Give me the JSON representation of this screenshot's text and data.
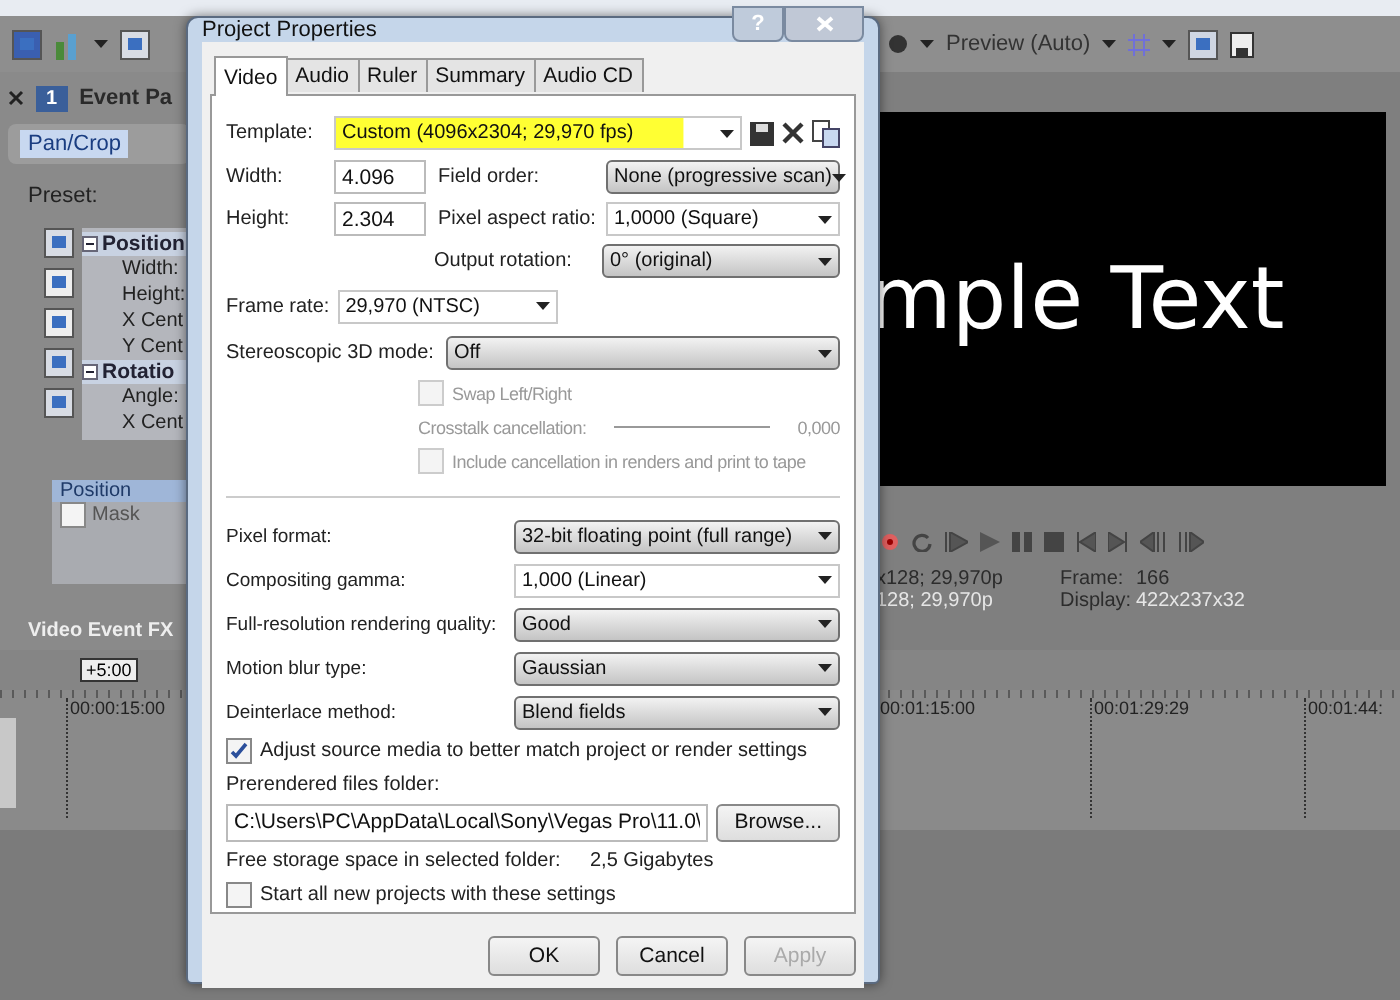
{
  "app": {
    "preview_toolbar": {
      "label": "Preview (Auto)"
    },
    "event_panel": {
      "tab_number": "1",
      "title": "Event Pa",
      "chip": "Pan/Crop",
      "preset_label": "Preset:",
      "tree": [
        {
          "label": "Position",
          "expanded": true,
          "children": [
            {
              "label": "Width:"
            },
            {
              "label": "Height:"
            },
            {
              "label": "X Cent"
            },
            {
              "label": "Y Cent"
            }
          ]
        },
        {
          "label": "Rotatio",
          "expanded": true,
          "children": [
            {
              "label": "Angle:"
            },
            {
              "label": "X Cent"
            }
          ]
        }
      ],
      "fx_list": [
        {
          "label": "Position",
          "selected": true
        },
        {
          "label": "Mask",
          "selected": false,
          "checked": false
        }
      ],
      "footer": "Video Event FX"
    },
    "preview": {
      "overlay_text": "mple Text",
      "status": [
        {
          "col_1": "x128; 29,970p",
          "col_2": "Frame:",
          "col_3": "166"
        },
        {
          "col_1": "128; 29,970p",
          "col_2": "Display:",
          "col_3": "422x237x32"
        }
      ]
    },
    "timeline": {
      "zoom_badge": "+5:00",
      "left_marks": [
        "00:00:15:00"
      ],
      "right_marks": [
        "00:01:15:00",
        "00:01:29:29",
        "00:01:44:"
      ]
    }
  },
  "dialog": {
    "title": "Project Properties",
    "help": "?",
    "tabs": [
      {
        "label": "Video",
        "selected": true
      },
      {
        "label": "Audio",
        "selected": false
      },
      {
        "label": "Ruler",
        "selected": false
      },
      {
        "label": "Summary",
        "selected": false
      },
      {
        "label": "Audio CD",
        "selected": false
      }
    ],
    "template": {
      "label": "Template:",
      "value": "Custom (4096x2304; 29,970 fps)",
      "highlighted": true
    },
    "width": {
      "label": "Width:",
      "value": "4.096"
    },
    "height": {
      "label": "Height:",
      "value": "2.304"
    },
    "field_order": {
      "label": "Field order:",
      "value": "None (progressive scan)",
      "kind": "list"
    },
    "pixel_aspect": {
      "label": "Pixel aspect ratio:",
      "value": "1,0000 (Square)"
    },
    "output_rotation": {
      "label": "Output rotation:",
      "value": "0° (original)",
      "kind": "list"
    },
    "frame_rate": {
      "label": "Frame rate:",
      "value": "29,970 (NTSC)"
    },
    "stereo": {
      "label": "Stereoscopic 3D mode:",
      "value": "Off",
      "kind": "list"
    },
    "swap": {
      "label": "Swap Left/Right",
      "checked": false,
      "disabled": true
    },
    "crosstalk": {
      "label": "Crosstalk cancellation:",
      "reading": "0,000",
      "disabled": true
    },
    "include": {
      "label": "Include cancellation in renders and print to tape",
      "checked": false,
      "disabled": true
    },
    "render_settings": [
      {
        "label": "Pixel format:",
        "value": "32-bit floating point (full range)",
        "kind": "list"
      },
      {
        "label": "Compositing gamma:",
        "value": "1,000 (Linear)",
        "kind": "combo"
      },
      {
        "label": "Full-resolution rendering quality:",
        "value": "Good",
        "kind": "list"
      },
      {
        "label": "Motion blur type:",
        "value": "Gaussian",
        "kind": "list"
      },
      {
        "label": "Deinterlace method:",
        "value": "Blend fields",
        "kind": "list"
      }
    ],
    "adjust": {
      "label": "Adjust source media to better match project or render settings",
      "checked": true,
      "disabled": false
    },
    "prerendered": {
      "label": "Prerendered files folder:",
      "value": "C:\\Users\\PC\\AppData\\Local\\Sony\\Vegas Pro\\11.0\\",
      "button": "Browse..."
    },
    "free_storage": {
      "label": "Free storage space in selected folder:",
      "value": "2,5 Gigabytes"
    },
    "start_all": {
      "label": "Start all new projects with these settings",
      "checked": false,
      "disabled": false
    },
    "buttons": [
      {
        "label": "OK",
        "disabled": false
      },
      {
        "label": "Cancel",
        "disabled": false
      },
      {
        "label": "Apply",
        "disabled": true
      }
    ]
  }
}
